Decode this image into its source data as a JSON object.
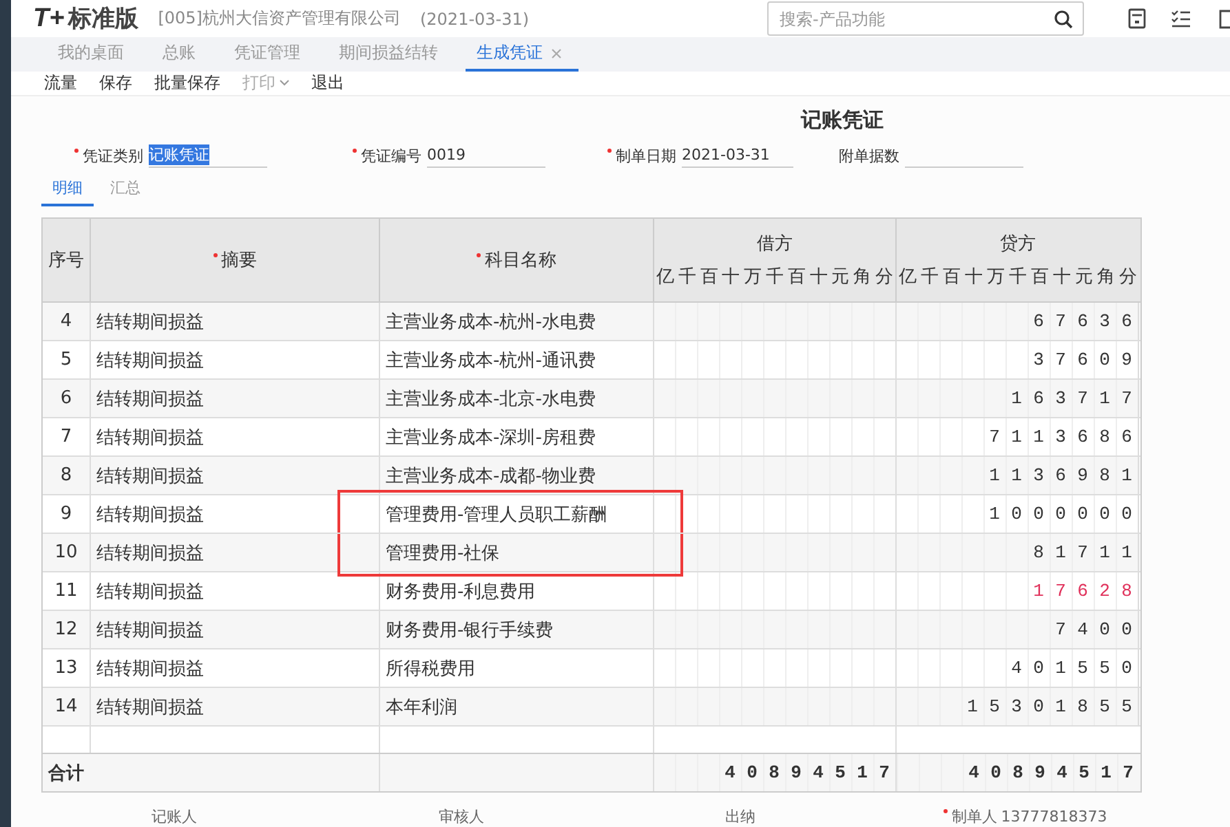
{
  "app": {
    "logo": "T+",
    "edition": "标准版",
    "company": "[005]杭州大信资产管理有限公司",
    "date": "(2021-03-31)"
  },
  "search": {
    "placeholder": "搜索-产品功能"
  },
  "tabs": [
    {
      "label": "我的桌面",
      "selected": false,
      "closable": false
    },
    {
      "label": "总账",
      "selected": false,
      "closable": false
    },
    {
      "label": "凭证管理",
      "selected": false,
      "closable": false
    },
    {
      "label": "期间损益结转",
      "selected": false,
      "closable": false
    },
    {
      "label": "生成凭证",
      "selected": true,
      "closable": true
    }
  ],
  "toolbar": [
    {
      "label": "流量",
      "disabled": false,
      "dropdown": false
    },
    {
      "label": "保存",
      "disabled": false,
      "dropdown": false
    },
    {
      "label": "批量保存",
      "disabled": false,
      "dropdown": false
    },
    {
      "label": "打印",
      "disabled": true,
      "dropdown": true
    },
    {
      "label": "退出",
      "disabled": false,
      "dropdown": false
    }
  ],
  "voucher": {
    "title": "记账凭证",
    "fields": [
      {
        "label": "凭证类别",
        "value": "记账凭证",
        "required": true,
        "text_selected": true
      },
      {
        "label": "凭证编号",
        "value": "0019",
        "required": true
      },
      {
        "label": "制单日期",
        "value": "2021-03-31",
        "required": true
      },
      {
        "label": "附单据数",
        "required": false
      }
    ],
    "subtabs": [
      {
        "label": "明细",
        "selected": true
      },
      {
        "label": "汇总",
        "selected": false
      }
    ]
  },
  "table": {
    "columns": [
      {
        "label": "序号",
        "required": false
      },
      {
        "label": "摘要",
        "required": true
      },
      {
        "label": "科目名称",
        "required": true
      }
    ],
    "debit": {
      "label": "借方",
      "units": [
        "亿",
        "千",
        "百",
        "十",
        "万",
        "千",
        "百",
        "十",
        "元",
        "角",
        "分"
      ]
    },
    "credit": {
      "label": "贷方",
      "units": [
        "亿",
        "千",
        "百",
        "十",
        "万",
        "千",
        "百",
        "十",
        "元",
        "角",
        "分"
      ]
    },
    "rows": [
      {
        "seq": "4",
        "summary": "结转期间损益",
        "subject": "主营业务成本-杭州-水电费",
        "credit": "67636",
        "negative": false,
        "highlighted": false
      },
      {
        "seq": "5",
        "summary": "结转期间损益",
        "subject": "主营业务成本-杭州-通讯费",
        "credit": "37609",
        "negative": false,
        "highlighted": false
      },
      {
        "seq": "6",
        "summary": "结转期间损益",
        "subject": "主营业务成本-北京-水电费",
        "credit": "163717",
        "negative": false,
        "highlighted": false
      },
      {
        "seq": "7",
        "summary": "结转期间损益",
        "subject": "主营业务成本-深圳-房租费",
        "credit": "7113686",
        "negative": false,
        "highlighted": false
      },
      {
        "seq": "8",
        "summary": "结转期间损益",
        "subject": "主营业务成本-成都-物业费",
        "credit": "1136981",
        "negative": false,
        "highlighted": false
      },
      {
        "seq": "9",
        "summary": "结转期间损益",
        "subject": "管理费用-管理人员职工薪酬",
        "credit": "1000000",
        "negative": false,
        "highlighted": true
      },
      {
        "seq": "10",
        "summary": "结转期间损益",
        "subject": "管理费用-社保",
        "credit": "81711",
        "negative": false,
        "highlighted": true
      },
      {
        "seq": "11",
        "summary": "结转期间损益",
        "subject": "财务费用-利息费用",
        "credit": "17628",
        "negative": true,
        "highlighted": false
      },
      {
        "seq": "12",
        "summary": "结转期间损益",
        "subject": "财务费用-银行手续费",
        "credit": "7400",
        "negative": false,
        "highlighted": false
      },
      {
        "seq": "13",
        "summary": "结转期间损益",
        "subject": "所得税费用",
        "credit": "401550",
        "negative": false,
        "highlighted": false
      },
      {
        "seq": "14",
        "summary": "结转期间损益",
        "subject": "本年利润",
        "credit": "15301855",
        "negative": false,
        "highlighted": false
      }
    ],
    "total": {
      "label": "合计",
      "debit": "40894517",
      "credit": "40894517"
    }
  },
  "signatures": [
    {
      "label": "记账人",
      "required": false
    },
    {
      "label": "审核人",
      "required": false
    },
    {
      "label": "出纳",
      "required": false
    },
    {
      "label": "制单人",
      "value": "13777818373",
      "required": true
    }
  ]
}
